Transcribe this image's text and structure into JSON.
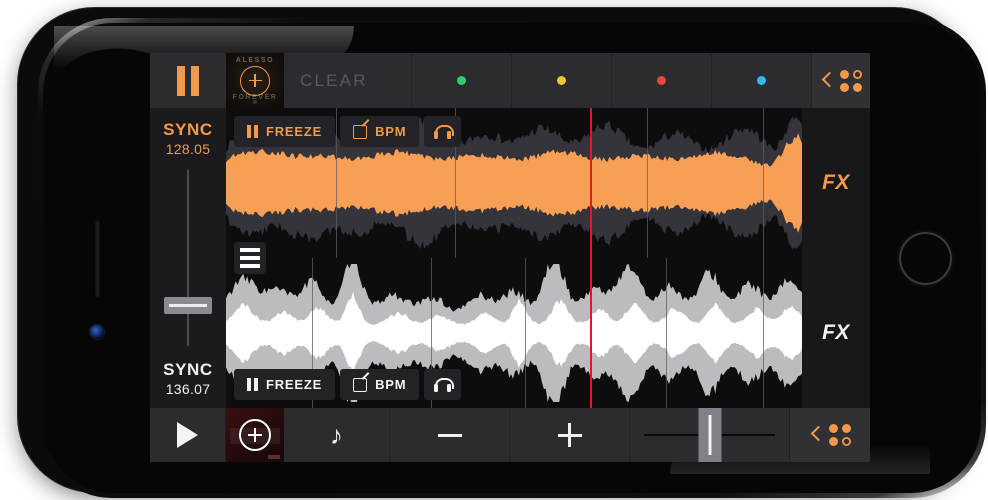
{
  "app": {
    "name": "dj-mixer-app",
    "accent_color": "#f2994a",
    "playhead_color": "#e01b20",
    "screen_bg": "#0a0a0b",
    "panel_bg": "#2c2c30"
  },
  "top_bar": {
    "pause_button": {
      "icon": "pause-icon",
      "label": ""
    },
    "album_art": {
      "artist": "ALESSO",
      "title": "FOREVER",
      "add_icon": "plus-circle-icon"
    },
    "clear_button": "CLEAR",
    "cue_points": [
      {
        "name": "cue-1",
        "color": "#2ecc71"
      },
      {
        "name": "cue-2",
        "color": "#efc530"
      },
      {
        "name": "cue-3",
        "color": "#e6483c"
      },
      {
        "name": "cue-4",
        "color": "#35b7ea"
      }
    ],
    "menu": {
      "chevron": "chevron-left-icon",
      "grid": "dot-grid-icon",
      "hollow_index": 1
    }
  },
  "deck_top": {
    "sync_label": "SYNC",
    "bpm_value": "128.05",
    "freeze_label": "FREEZE",
    "bpm_label": "BPM",
    "cue_icon": "headphones-icon",
    "fx_label": "FX",
    "wave_color": "#f7a055",
    "wave_bg_color": "#34343a"
  },
  "deck_bottom": {
    "sync_label": "SYNC",
    "bpm_value": "136.07",
    "freeze_label": "FREEZE",
    "bpm_label": "BPM",
    "cue_icon": "headphones-icon",
    "fx_label": "FX",
    "wave_color": "#ffffff",
    "wave_bg_color": "#bcbcc0"
  },
  "center": {
    "vertical_fader": {
      "name": "deck-balance-fader",
      "position_percent": 72
    },
    "menu_icon": "hamburger-menu-icon"
  },
  "bottom_bar": {
    "play_button": "play-icon",
    "library_art": {
      "add_icon": "plus-circle-icon"
    },
    "music_note": "♪",
    "minus_button": "−",
    "plus_button": "+",
    "crossfader": {
      "name": "crossfader",
      "position_percent": 50
    },
    "menu": {
      "chevron": "chevron-left-icon",
      "grid": "dot-grid-icon",
      "hollow_index": 3
    }
  },
  "device": {
    "type": "smartphone-landscape",
    "home_button": "home-button"
  }
}
